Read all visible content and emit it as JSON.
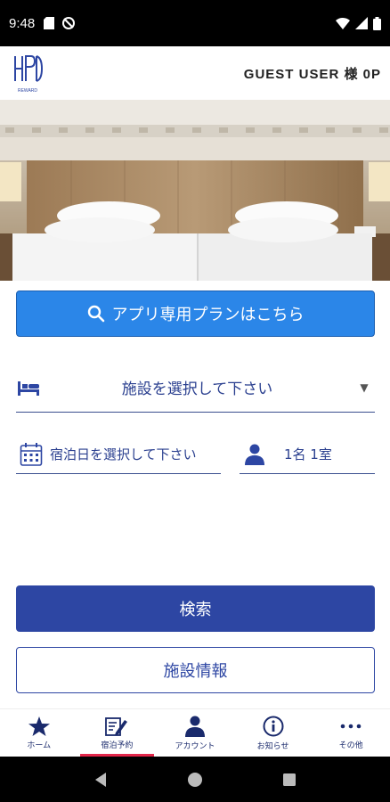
{
  "status_bar": {
    "time": "9:48"
  },
  "header": {
    "user_label": "GUEST USER 様 0P",
    "logo_sub": "REWARD"
  },
  "promo": {
    "label": "アプリ専用プランはこちら"
  },
  "facility": {
    "placeholder": "施設を選択して下さい"
  },
  "date": {
    "placeholder": "宿泊日を選択して下さい"
  },
  "guests": {
    "value": "1名 1室"
  },
  "actions": {
    "search": "検索",
    "facility_info": "施設情報"
  },
  "bottom_nav": [
    {
      "label": "ホーム",
      "icon": "star-icon"
    },
    {
      "label": "宿泊予約",
      "icon": "booking-icon",
      "active": true
    },
    {
      "label": "アカウント",
      "icon": "person-icon"
    },
    {
      "label": "お知らせ",
      "icon": "info-icon"
    },
    {
      "label": "その他",
      "icon": "more-icon"
    }
  ],
  "colors": {
    "primary": "#2d46a3",
    "promo": "#2b86e8",
    "active_indicator": "#e2264a"
  }
}
